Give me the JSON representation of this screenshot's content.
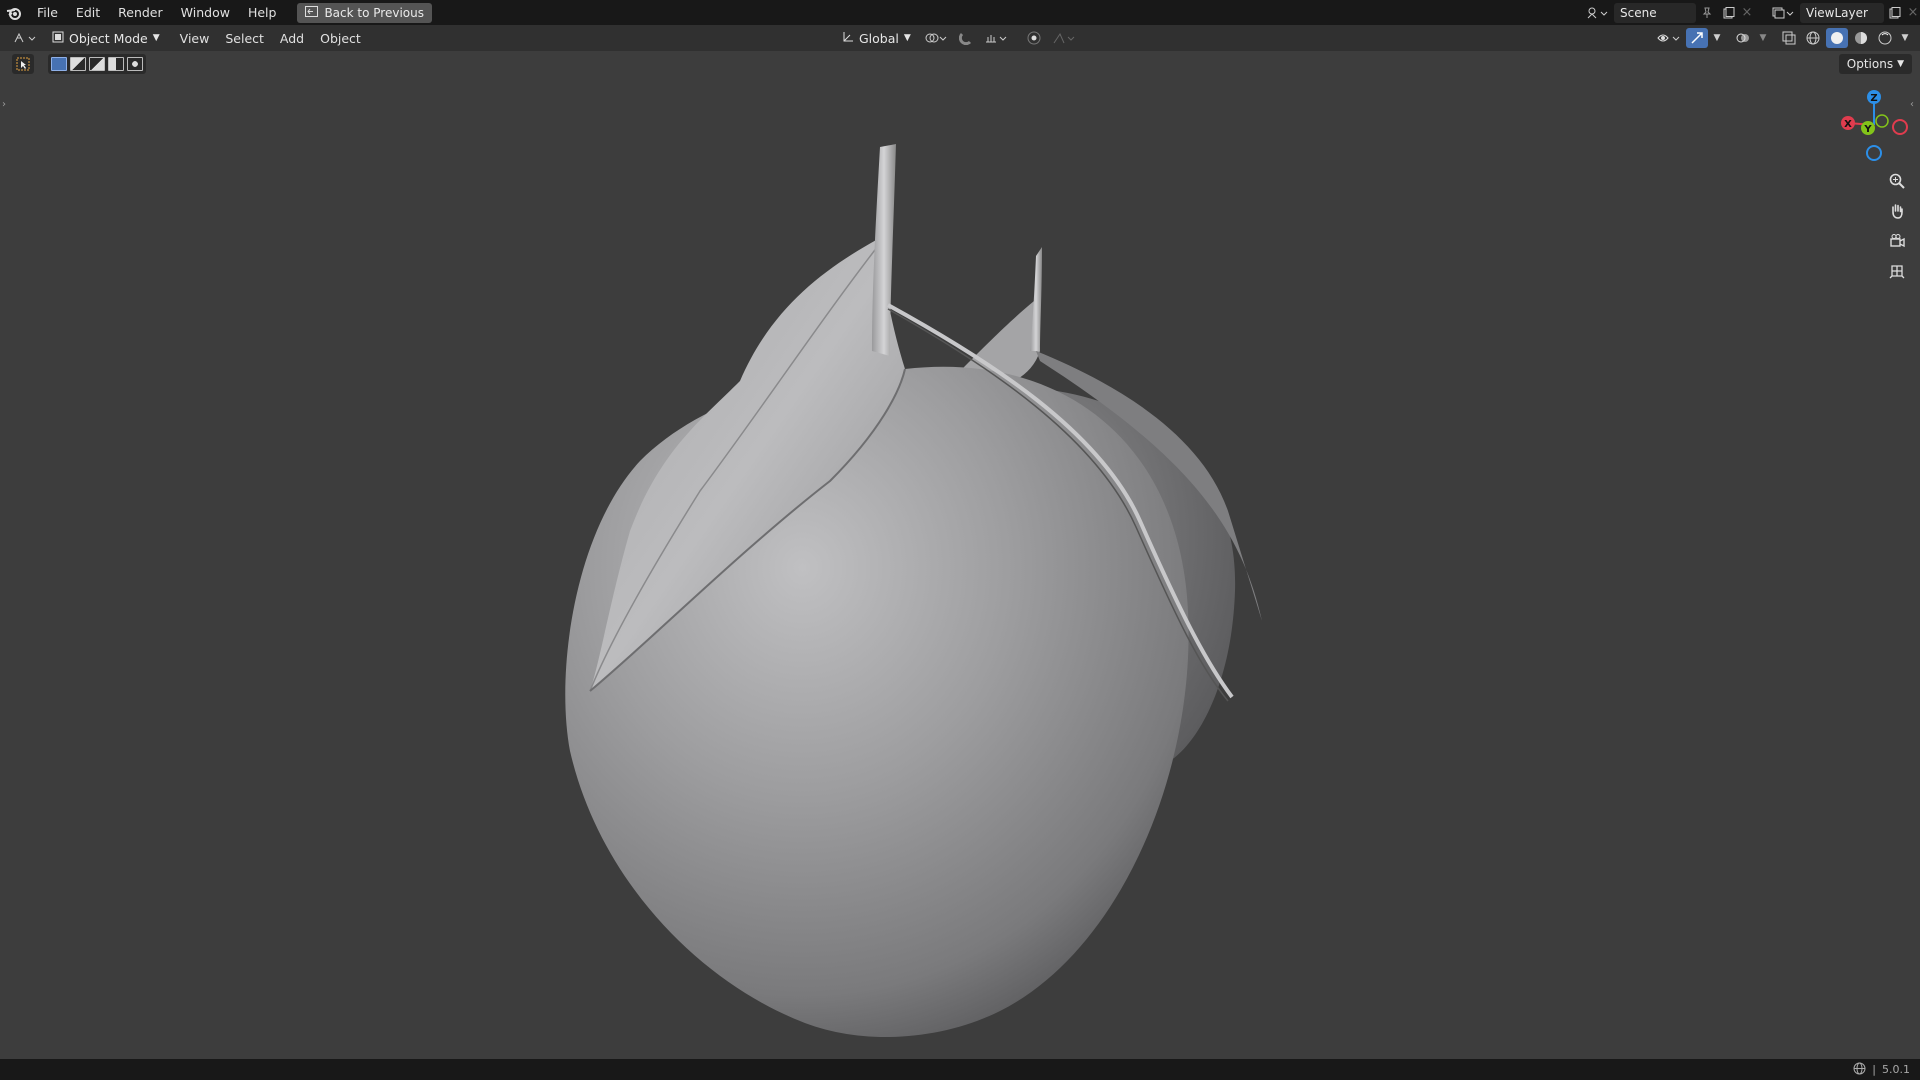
{
  "topbar": {
    "menus": [
      "File",
      "Edit",
      "Render",
      "Window",
      "Help"
    ],
    "back_button": "Back to Previous",
    "scene": "Scene",
    "view_layer": "ViewLayer"
  },
  "header": {
    "mode": "Object Mode",
    "menus": [
      "View",
      "Select",
      "Add",
      "Object"
    ],
    "transform_orientation": "Global"
  },
  "viewport": {
    "options_label": "Options",
    "gizmo": {
      "x_label": "X",
      "y_label": "Y",
      "z_label": "Z"
    },
    "object": "apple-model",
    "nav_icons": [
      "zoom-icon",
      "pan-hand-icon",
      "camera-view-icon",
      "grid-view-icon"
    ]
  },
  "statusbar": {
    "version": "5.0.1"
  },
  "colors": {
    "active_mode": "#4772b3",
    "x_axis": "#e03c4e",
    "y_axis": "#83c41a",
    "z_axis": "#2c8fe8"
  }
}
